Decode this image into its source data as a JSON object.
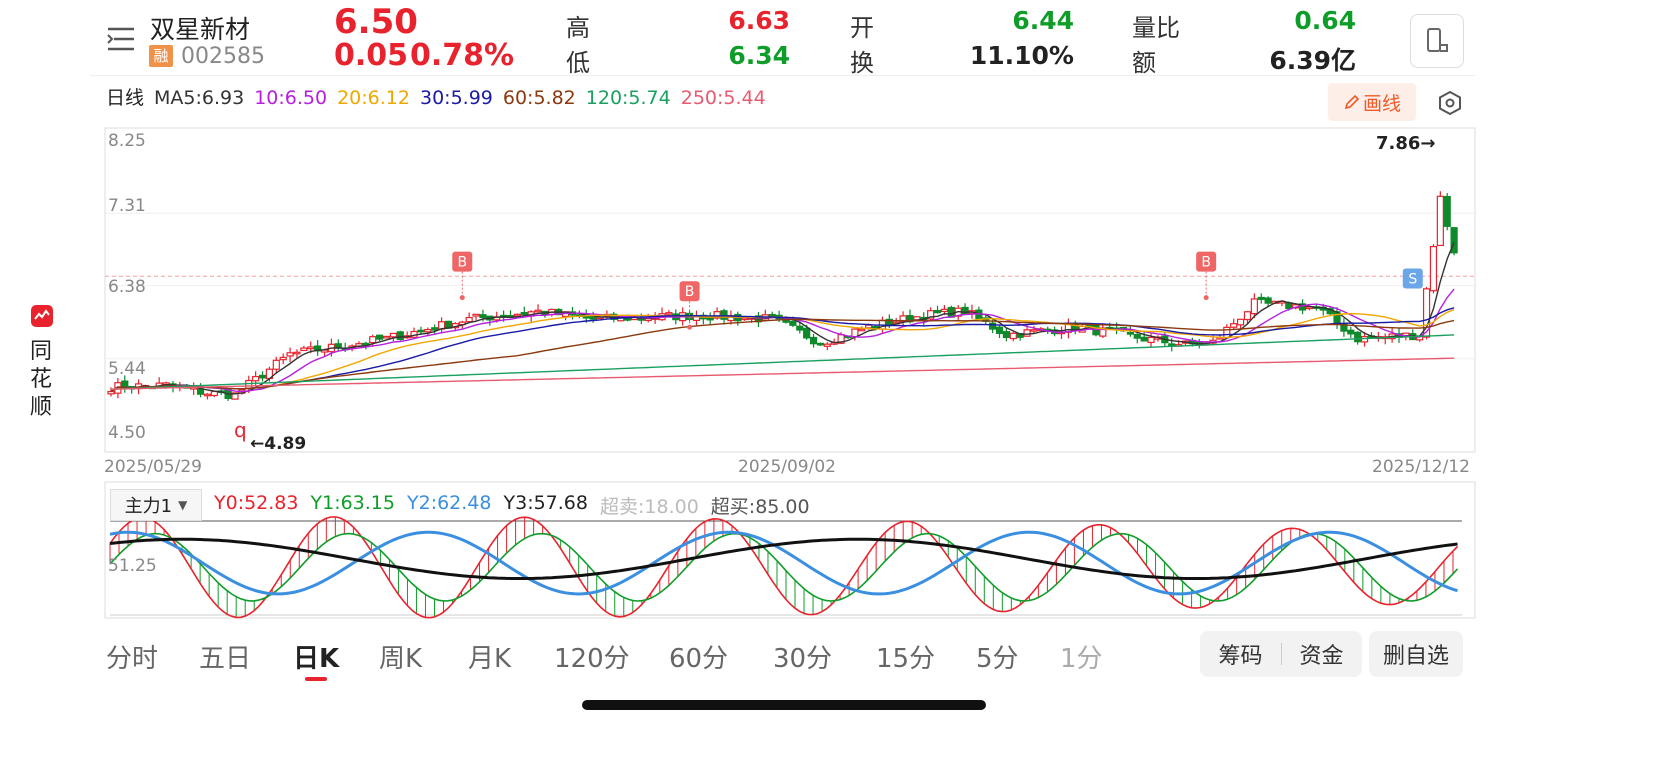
{
  "header": {
    "stock_name": "双星新材",
    "margin_badge": "融",
    "stock_code": "002585",
    "price": "6.50",
    "change": "0.05",
    "change_pct": "0.78%",
    "high_label": "高",
    "high": "6.63",
    "low_label": "低",
    "low": "6.34",
    "open_label": "开",
    "open": "6.44",
    "turnover_label": "换",
    "turnover": "11.10%",
    "volume_ratio_label": "量比",
    "volume_ratio": "0.64",
    "amount_label": "额",
    "amount": "6.39亿"
  },
  "sidebar": {
    "brand_chars": [
      "同",
      "花",
      "顺"
    ]
  },
  "ma_legend": {
    "period": "日线",
    "items": [
      {
        "text": "MA5:6.93",
        "color": "#333333"
      },
      {
        "text": "10:6.50",
        "color": "#b620e0"
      },
      {
        "text": "20:6.12",
        "color": "#f0a800"
      },
      {
        "text": "30:5.99",
        "color": "#1a1aa6"
      },
      {
        "text": "60:5.82",
        "color": "#8b3a0f"
      },
      {
        "text": "120:5.74",
        "color": "#1aa060"
      },
      {
        "text": "250:5.44",
        "color": "#e85a70"
      }
    ]
  },
  "draw_button": "画线",
  "chart_data": [
    {
      "type": "candlestick",
      "y_ticks": [
        "8.25",
        "7.31",
        "6.38",
        "5.44",
        "4.50"
      ],
      "ylim": [
        4.5,
        8.25
      ],
      "x_labels": [
        "2025/05/29",
        "2025/09/02",
        "2025/12/12"
      ],
      "high_marker": "7.86→",
      "low_marker": "←4.89",
      "low_marker_letter": "q",
      "last_price_line": 6.5,
      "signals": [
        {
          "label": "B",
          "index": 51,
          "price": 6.38
        },
        {
          "label": "B",
          "index": 84,
          "price": 6.0
        },
        {
          "label": "B",
          "index": 159,
          "price": 6.38
        },
        {
          "label": "S",
          "index": 189,
          "price": 6.6
        }
      ],
      "series_colors": {
        "up": "#e8232d",
        "down": "#0f8a2a"
      }
    },
    {
      "type": "line",
      "indicator": "主力1",
      "values": [
        {
          "text": "Y0:52.83",
          "color": "#e8232d"
        },
        {
          "text": "Y1:63.15",
          "color": "#0f9d2a"
        },
        {
          "text": "Y2:62.48",
          "color": "#3b8fe0"
        },
        {
          "text": "Y3:57.68",
          "color": "#222222"
        },
        {
          "text": "超卖:18.00",
          "color": "#bbbbbb"
        },
        {
          "text": "超买:85.00",
          "color": "#555555"
        }
      ],
      "y_tick": "51.25"
    }
  ],
  "period_tabs": [
    "分时",
    "五日",
    "日K",
    "周K",
    "月K",
    "120分",
    "60分",
    "30分",
    "15分",
    "5分",
    "1分"
  ],
  "active_tab": "日K",
  "bottom_buttons": {
    "chips": "筹码",
    "funds": "资金",
    "remove": "删自选"
  }
}
